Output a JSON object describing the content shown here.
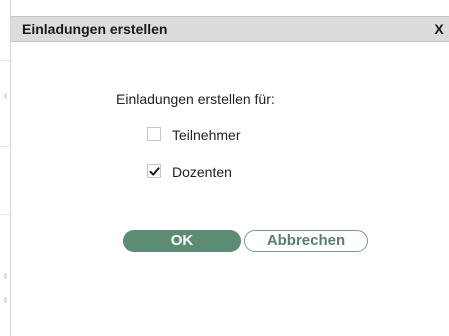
{
  "dialog": {
    "title": "Einladungen erstellen",
    "close_label": "X",
    "prompt": "Einladungen erstellen für:",
    "options": [
      {
        "label": "Teilnehmer",
        "checked": false
      },
      {
        "label": "Dozenten",
        "checked": true
      }
    ],
    "buttons": {
      "ok_label": "OK",
      "cancel_label": "Abbrechen"
    }
  },
  "colors": {
    "titlebar_bg": "#dcdcdc",
    "primary_button": "#5c8c72",
    "secondary_button_border": "#7b9c8a",
    "secondary_button_text": "#5c7d6c"
  },
  "icons": {
    "checkbox_checked": "checkmark-icon"
  }
}
